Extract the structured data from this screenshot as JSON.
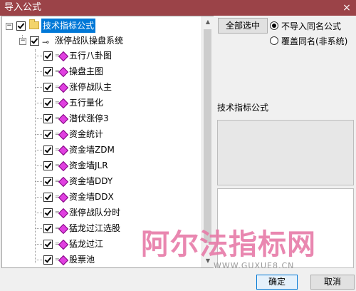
{
  "window": {
    "title": "导入公式",
    "close_glyph": "×"
  },
  "tree": {
    "root": {
      "label": "技术指标公式",
      "checked": true,
      "selected": true
    },
    "group": {
      "label": "涨停战队操盘系统",
      "checked": true
    },
    "items": [
      {
        "label": "五行八卦图",
        "checked": true
      },
      {
        "label": "操盘主图",
        "checked": true
      },
      {
        "label": "涨停战队主",
        "checked": true
      },
      {
        "label": "五行量化",
        "checked": true
      },
      {
        "label": "潜伏涨停3",
        "checked": true
      },
      {
        "label": "资金统计",
        "checked": true
      },
      {
        "label": "资金墙ZDM",
        "checked": true
      },
      {
        "label": "资金墙JLR",
        "checked": true
      },
      {
        "label": "资金墙DDY",
        "checked": true
      },
      {
        "label": "资金墙DDX",
        "checked": true
      },
      {
        "label": "涨停战队分时",
        "checked": true
      },
      {
        "label": "猛龙过江选股",
        "checked": true
      },
      {
        "label": "猛龙过江",
        "checked": true
      },
      {
        "label": "股票池",
        "checked": true
      }
    ]
  },
  "options": {
    "select_all_label": "全部选中",
    "radio_no_import": "不导入同名公式",
    "radio_overwrite": "覆盖同名(非系统)",
    "selected_radio": "no_import"
  },
  "detail": {
    "title": "技术指标公式"
  },
  "watermark": {
    "main": "阿尔法指标网",
    "url": "WWW.GUXUE8.CN"
  },
  "footer": {
    "ok_label": "确定",
    "cancel_label": "取消"
  },
  "colors": {
    "titlebar": "#9b4348",
    "selection": "#0078d7",
    "watermark": "#e77ba8"
  }
}
